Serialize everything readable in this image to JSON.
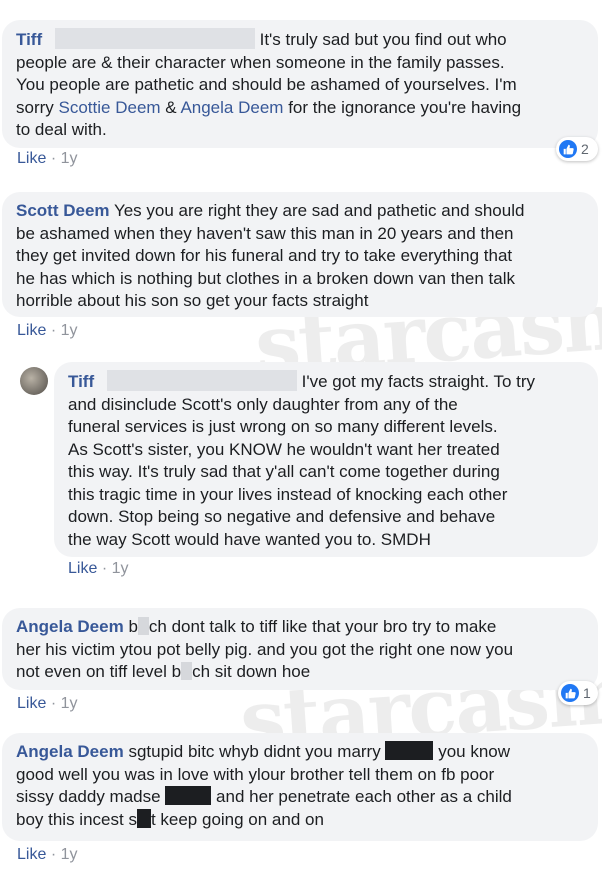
{
  "like_label": "Like",
  "separator": "·",
  "watermark": "starcasm",
  "comments": [
    {
      "author": "Tiff",
      "lines": [
        "It's truly sad but you find out who",
        "people are & their character when someone in the family passes.",
        "You people are pathetic and should be ashamed of yourselves. I'm"
      ],
      "line4_pre": "sorry",
      "mention1": "Scottie Deem",
      "amp": "&",
      "mention2": "Angela Deem",
      "line4_post": "for the ignorance you're having",
      "line5": "to deal with.",
      "age": "1y",
      "reactions": "2"
    },
    {
      "author": "Scott Deem",
      "lines": [
        "Yes you are right they are sad and pathetic and should",
        "be ashamed when they haven't saw this man in 20 years and then",
        "they get invited down for his funeral and try to take everything that",
        "he has which is nothing but clothes in a broken down van then talk",
        "horrible about his son so get your facts straight"
      ],
      "age": "1y"
    },
    {
      "author": "Tiff",
      "lines": [
        "I've got my facts straight. To try",
        "and disinclude Scott's only daughter from any of the",
        "funeral services is just wrong on so many different levels.",
        "As Scott's sister, you KNOW he wouldn't want her treated",
        "this way. It's truly sad that y'all can't come together during",
        "this tragic time in your lives instead of knocking each other",
        "down. Stop being so negative and defensive and behave",
        "the way Scott would have wanted you to. SMDH"
      ],
      "age": "1y"
    },
    {
      "author": "Angela Deem",
      "l1a": "b",
      "l1b": "ch dont talk to tiff like that your bro try to make",
      "line2": "her his victim ytou pot belly pig. and you got the right one now you",
      "l3a": "not even on tiff level b",
      "l3b": "ch sit down hoe",
      "age": "1y",
      "reactions": "1"
    },
    {
      "author": "Angela Deem",
      "l1a": "sgtupid bitc whyb didnt you marry",
      "l1b": "you know",
      "line2": "good well you was in love with ylour brother tell them on fb poor",
      "l3a": "sissy daddy madse",
      "l3b": "and her penetrate each other as a child",
      "l4a": "boy this incest s",
      "l4b": "t keep going on and on",
      "age": "1y"
    }
  ]
}
